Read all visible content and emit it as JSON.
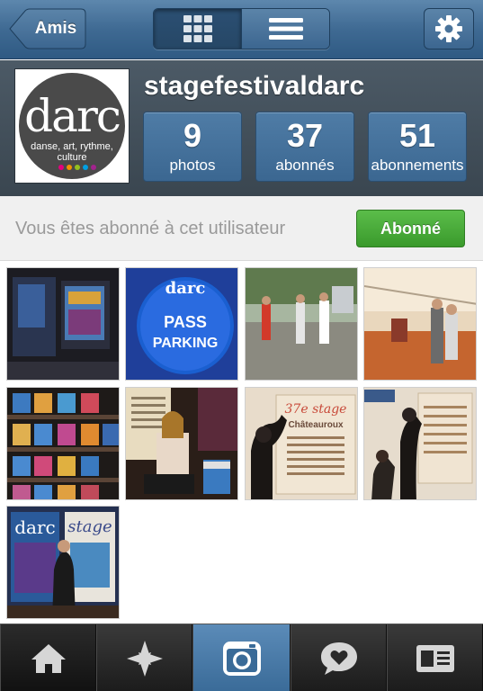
{
  "nav": {
    "back_label": "Amis"
  },
  "profile": {
    "username": "stagefestivaldarc",
    "avatar": {
      "word": "darc",
      "subtitle_line1": "danse, art, rythme,",
      "subtitle_line2": "culture"
    },
    "stats": [
      {
        "value": "9",
        "label": "photos"
      },
      {
        "value": "37",
        "label": "abonnés"
      },
      {
        "value": "51",
        "label": "abonnements"
      }
    ]
  },
  "follow": {
    "status_text": "Vous êtes abonné à cet utilisateur",
    "button_label": "Abonné"
  },
  "photos": {
    "p2_line1": "PASS",
    "p2_line2": "PARKING",
    "p7_title": "37e stage",
    "p7_city": "Châteauroux",
    "p9_word": "darc",
    "p9_stage": "stage"
  },
  "colors": {
    "nav_blue": "#3f6a93",
    "profile_bg": "#3a4650",
    "follow_green": "#3a9a2c",
    "camera_tab_blue": "#3a6b98"
  },
  "icons": [
    "back-arrow-icon",
    "grid-view-icon",
    "list-view-icon",
    "gear-icon",
    "home-icon",
    "explore-star-icon",
    "camera-icon",
    "news-bubble-icon",
    "profile-card-icon"
  ]
}
